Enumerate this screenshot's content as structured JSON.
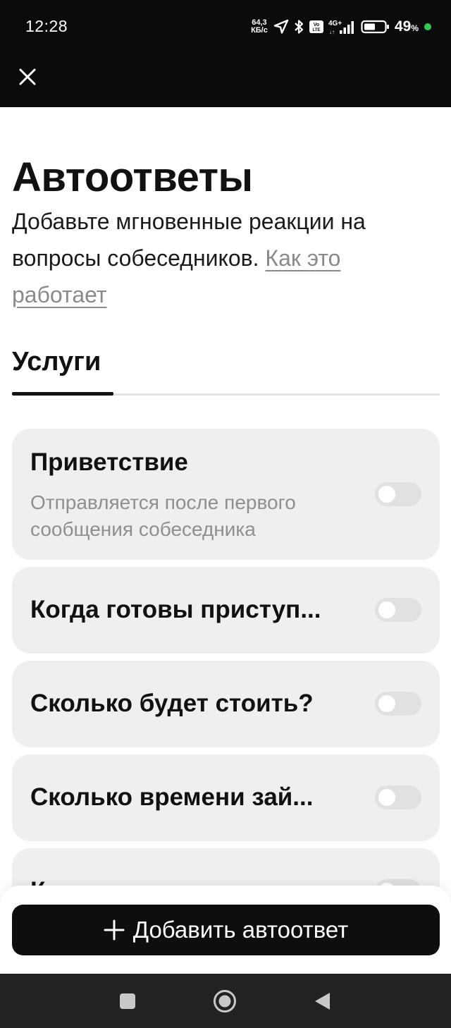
{
  "status_bar": {
    "time": "12:28",
    "net_speed_value": "64,3",
    "net_speed_unit": "КБ/с",
    "network": "4G+",
    "battery_percent": "49",
    "battery_percent_sign": "%",
    "icons": [
      "location-arrow-icon",
      "bluetooth-icon",
      "volte-icon",
      "signal-icon",
      "battery-icon"
    ]
  },
  "header": {
    "close_icon": "close-icon"
  },
  "page": {
    "title": "Автоответы",
    "subtitle": "Добавьте мгновенные реакции на вопросы собеседников.",
    "link_text": "Как это работает"
  },
  "tabs": [
    {
      "label": "Услуги",
      "active": true
    }
  ],
  "cards": [
    {
      "title": "Приветствие",
      "description": "Отправляется после первого сообщения собеседника",
      "enabled": false
    },
    {
      "title": "Когда готовы приступ...",
      "enabled": false
    },
    {
      "title": "Сколько будет стоить?",
      "enabled": false
    },
    {
      "title": "Сколько времени зай...",
      "enabled": false
    },
    {
      "title": "К",
      "enabled": false
    }
  ],
  "add_button": {
    "icon": "plus-icon",
    "label": "Добавить автоответ"
  },
  "nav": {
    "icons": [
      "recents-square-icon",
      "home-circle-icon",
      "back-triangle-icon"
    ]
  },
  "colors": {
    "accent": "#0e0e0e",
    "card_bg": "#f0efee",
    "link": "#8a8a8a",
    "toggle_off": "#e2e1e0"
  }
}
